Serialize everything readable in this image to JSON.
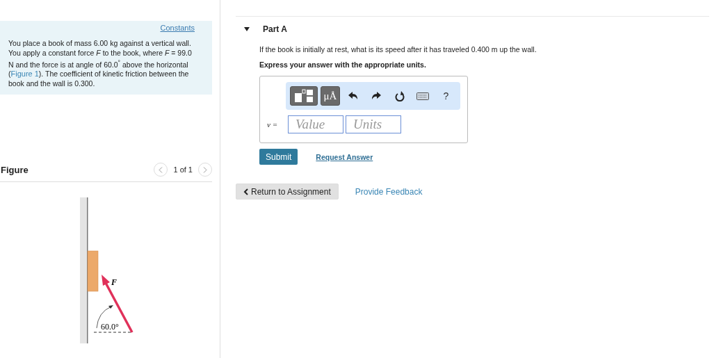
{
  "constants_link": "Constants",
  "problem": {
    "before": "You place a book of mass 6.00 kg against a vertical wall. You apply a constant force *F* to the book, where *F* = 99.0 N and the force is at angle of 60.0$^{°}$ above the horizontal (",
    "link": "Figure 1",
    "after": "). The coefficient of kinetic friction between the book and the wall is 0.300."
  },
  "figure": {
    "title": "Figure",
    "pager": "1 of 1",
    "force_label": "F",
    "angle_label": "60.0°"
  },
  "part": {
    "title": "Part A",
    "expanded": true,
    "question": "If the book is initially at rest, what is its speed after it has traveled 0.400 m up the wall.",
    "instruction": "Express your answer with the appropriate units.",
    "toolbar": [
      {
        "kind": "templates"
      },
      {
        "kind": "units",
        "label": "μÅ"
      },
      {
        "kind": "undo"
      },
      {
        "kind": "redo"
      },
      {
        "kind": "reset"
      },
      {
        "kind": "keyboard"
      },
      {
        "kind": "help",
        "label": "?"
      }
    ],
    "variable": "v =",
    "value_placeholder": "Value",
    "units_placeholder": "Units",
    "submit": "Submit",
    "request": "Request Answer"
  },
  "return_button": "Return to Assignment",
  "feedback_link": "Provide Feedback"
}
